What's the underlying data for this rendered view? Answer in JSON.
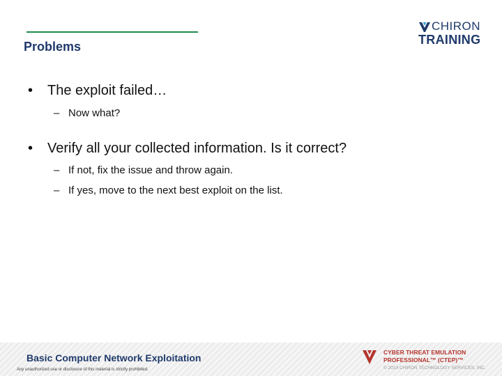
{
  "header": {
    "title": "Problems",
    "logo": {
      "top": "CHIRON",
      "bottom": "TRAINING",
      "icon": "chiron-logo-icon"
    }
  },
  "content": {
    "bullets": [
      {
        "text": "The exploit failed…",
        "subs": [
          "Now what?"
        ]
      },
      {
        "text": "Verify all your collected information.  Is it correct?",
        "subs": [
          "If not, fix the issue and throw again.",
          "If yes, move to the next best exploit on the list."
        ]
      }
    ],
    "bullet_glyph": "•",
    "dash_glyph": "–"
  },
  "footer": {
    "course": "Basic Computer Network Exploitation",
    "notice": "Any unauthorized use or disclosure of this material is strictly prohibited.",
    "program_line1": "CYBER THREAT EMULATION",
    "program_line2": "PROFESSIONAL™ (CTEP)™",
    "copyright": "© 2019 CHIRON TECHNOLOGY SERVICES, INC."
  },
  "colors": {
    "accent_green": "#1f8a4c",
    "navy": "#1f3a6b",
    "ctep_red": "#b5342d"
  }
}
